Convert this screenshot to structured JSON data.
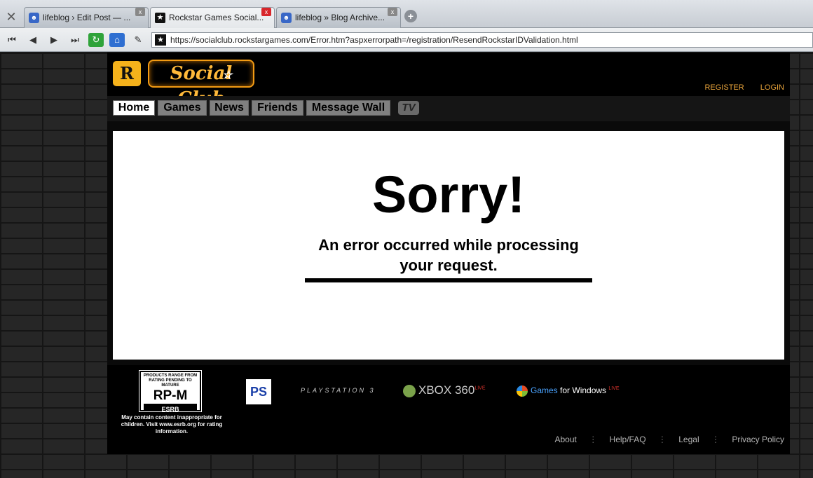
{
  "browser": {
    "tabs": [
      {
        "label": "lifeblog › Edit Post — ...",
        "favicon": "blog-icon",
        "close": "x"
      },
      {
        "label": "Rockstar Games Social...",
        "favicon": "rockstar-icon",
        "close": "x"
      },
      {
        "label": "lifeblog » Blog Archive...",
        "favicon": "blog-icon",
        "close": "x"
      }
    ],
    "url": "https://socialclub.rockstargames.com/Error.htm?aspxerrorpath=/registration/ResendRockstarIDValidation.html"
  },
  "site": {
    "r_logo": "R",
    "social_club_logo": "Social Club",
    "top_links": {
      "register": "REGISTER",
      "login": "LOGIN"
    },
    "nav": [
      {
        "label": "Home"
      },
      {
        "label": "Games"
      },
      {
        "label": "News"
      },
      {
        "label": "Friends"
      },
      {
        "label": "Message Wall"
      }
    ],
    "tv": "TV",
    "error": {
      "title": "Sorry!",
      "message": "An error occurred while processing your request."
    },
    "footer": {
      "esrb_top": "PRODUCTS RANGE FROM RATING PENDING TO MATURE",
      "esrb_rating": "RP-M",
      "esrb_bottom": "ESRB",
      "esrb_note": "May contain content inappropriate for children. Visit www.esrb.org for rating information.",
      "playstation3": "PLAYSTATION 3",
      "xbox": "XBOX 360",
      "xbox_live": "LIVE",
      "gfw_games": "Games",
      "gfw_rest": "for Windows",
      "gfw_live": "LIVE",
      "links": [
        "About",
        "Help/FAQ",
        "Legal",
        "Privacy Policy"
      ]
    }
  },
  "colors": {
    "accent": "#e8a33a",
    "nav_bg": "#808080",
    "active_tab_close": "#d8262b"
  }
}
